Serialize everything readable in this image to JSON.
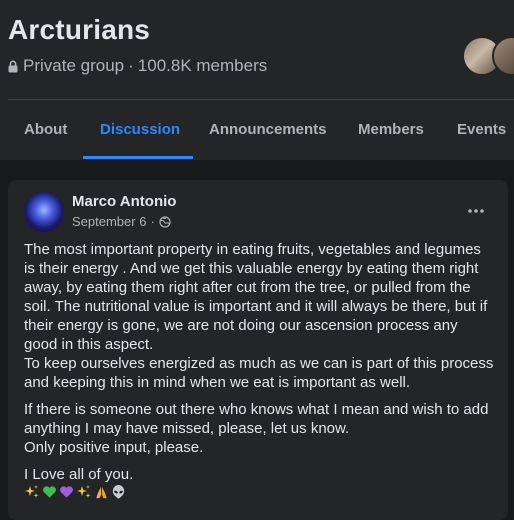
{
  "group": {
    "name": "Arcturians",
    "privacy": "Private group",
    "separator": "·",
    "members": "100.8K members"
  },
  "tabs": [
    {
      "label": "About",
      "active": false
    },
    {
      "label": "Discussion",
      "active": true
    },
    {
      "label": "Announcements",
      "active": false
    },
    {
      "label": "Members",
      "active": false
    },
    {
      "label": "Events",
      "active": false
    }
  ],
  "post": {
    "author": "Marco Antonio",
    "date": "September 6",
    "date_separator": "·",
    "audience_icon": "globe-icon",
    "more_icon": "more-options-icon",
    "paragraphs": [
      "The most important property in eating fruits, vegetables and legumes is their energy . And we get this valuable energy by eating them right away, by eating them right after cut from the tree, or pulled from the soil. The nutritional value is important and it will always be there, but if their energy is gone, we are not doing our ascension process any good in this aspect.\nTo keep ourselves energized as much as we can is part of this process and keeping this in mind when we eat is important as well.",
      "If there is someone out there who knows what I mean and wish to add anything I may have missed, please, let us know.\nOnly positive input, please.",
      "I Love all of you."
    ],
    "emojis": [
      "sparkles",
      "green-heart",
      "purple-heart",
      "sparkles",
      "folded-hands",
      "alien"
    ]
  },
  "colors": {
    "accent": "#2d88ff",
    "background": "#18191a",
    "surface": "#242526",
    "text_primary": "#e4e6eb",
    "text_secondary": "#b0b3b8"
  }
}
